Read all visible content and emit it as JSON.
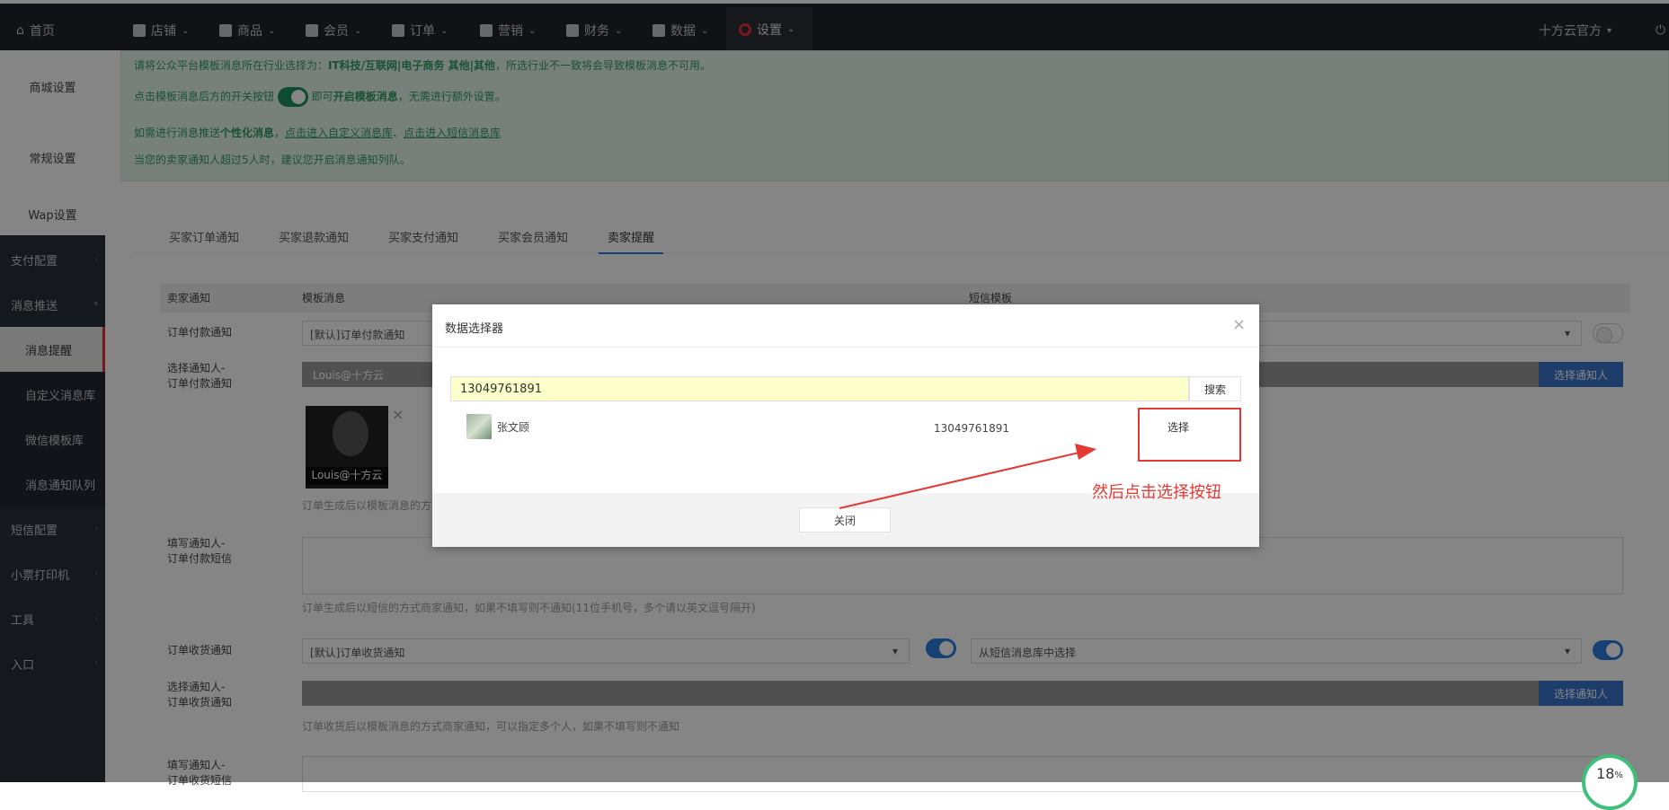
{
  "topbar": {
    "home": "首页",
    "menus": [
      "店铺",
      "商品",
      "会员",
      "订单",
      "营销",
      "财务",
      "数据",
      "设置"
    ],
    "user": "十方云官方"
  },
  "sidebar": {
    "items": [
      "商城设置",
      "常规设置",
      "Wap设置",
      "支付配置",
      "消息推送",
      "消息提醒",
      "自定义消息库",
      "微信模板库",
      "消息通知队列",
      "短信配置",
      "小票打印机",
      "工具",
      "入口"
    ]
  },
  "notice": {
    "line1_prefix": "请将公众平台模板消息所在行业选择为：",
    "line1_bold": "IT科技/互联网|电子商务 其他|其他",
    "line1_suffix": "，所选行业不一致将会导致模板消息不可用。",
    "line2_prefix": "点击模板消息后方的开关按钮",
    "line2_mid": "即可",
    "line2_bold": "开启模板消息",
    "line2_suffix": "，无需进行额外设置。",
    "line3_prefix": "如需进行消息推送",
    "line3_bold": "个性化消息",
    "line3_link1": "点击进入自定义消息库",
    "line3_link2": "点击进入短信消息库",
    "line4": "当您的卖家通知人超过5人时，建议您开启消息通知列队。"
  },
  "tabs": [
    "买家订单通知",
    "买家退款通知",
    "买家支付通知",
    "买家会员通知",
    "卖家提醒"
  ],
  "table": {
    "headers": [
      "卖家通知",
      "模板消息",
      "短信模板"
    ],
    "row1_label": "订单付款通知",
    "row1_select": "[默认]订单付款通知",
    "row2_label_a": "选择通知人-",
    "row2_label_b": "订单付款通知",
    "row2_value": "Louis@十方云",
    "select_notify_btn": "选择通知人",
    "avatar_caption": "Louis@十方云",
    "hint1": "订单生成后以模板消息的方",
    "row3_label_a": "填写通知人-",
    "row3_label_b": "订单付款短信",
    "hint2": "订单生成后以短信的方式商家通知，如果不填写则不通知(11位手机号，多个请以英文逗号隔开)",
    "row4_label": "订单收货通知",
    "row4_select": "[默认]订单收货通知",
    "row4_sms_select": "从短信消息库中选择",
    "row5_label_a": "选择通知人-",
    "row5_label_b": "订单收货通知",
    "hint3": "订单收货后以模板消息的方式商家通知，可以指定多个人，如果不填写则不通知",
    "row6_label_a": "填写通知人-",
    "row6_label_b": "订单收货短信"
  },
  "modal": {
    "title": "数据选择器",
    "search_value": "13049761891",
    "search_button": "搜索",
    "result_name": "张文顾",
    "result_phone": "13049761891",
    "select_button": "选择",
    "close_button": "关闭"
  },
  "annotation": "然后点击选择按钮",
  "progress": {
    "value": "18",
    "unit": "%"
  },
  "colors": {
    "accent_red": "#e53935",
    "green": "#2f9c66",
    "blue": "#3a73c9"
  }
}
